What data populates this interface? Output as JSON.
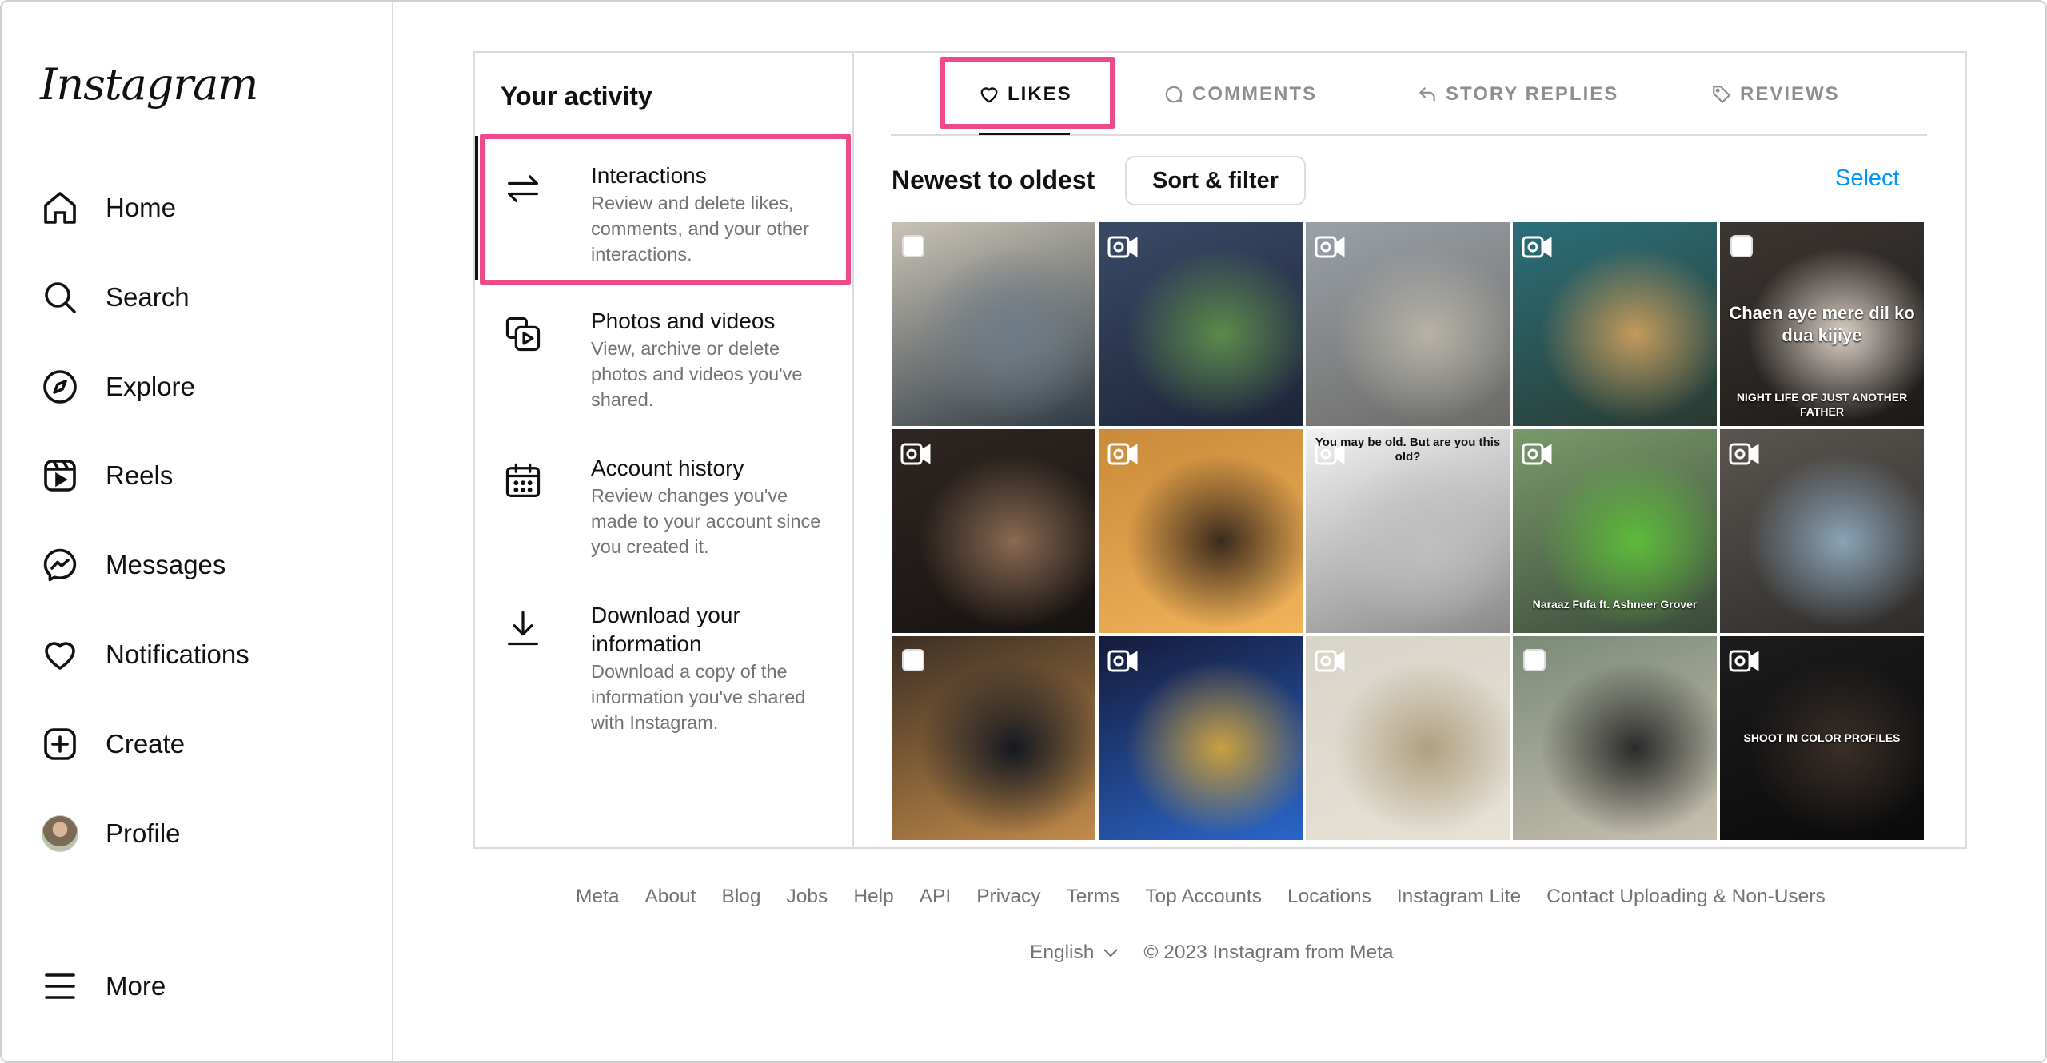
{
  "brand": "Instagram",
  "nav": [
    {
      "label": "Home",
      "icon": "home-icon"
    },
    {
      "label": "Search",
      "icon": "search-icon"
    },
    {
      "label": "Explore",
      "icon": "compass-icon"
    },
    {
      "label": "Reels",
      "icon": "reels-icon"
    },
    {
      "label": "Messages",
      "icon": "messenger-icon"
    },
    {
      "label": "Notifications",
      "icon": "heart-icon"
    },
    {
      "label": "Create",
      "icon": "plus-square-icon"
    },
    {
      "label": "Profile",
      "icon": "avatar"
    },
    {
      "label": "More",
      "icon": "menu-icon"
    }
  ],
  "activity": {
    "title": "Your activity",
    "items": [
      {
        "title": "Interactions",
        "desc": "Review and delete likes, comments, and your other interactions.",
        "icon": "arrows-icon"
      },
      {
        "title": "Photos and videos",
        "desc": "View, archive or delete photos and videos you've shared.",
        "icon": "media-icon"
      },
      {
        "title": "Account history",
        "desc": "Review changes you've made to your account since you created it.",
        "icon": "calendar-icon"
      },
      {
        "title": "Download your information",
        "desc": "Download a copy of the information you've shared with Instagram.",
        "icon": "download-icon"
      }
    ]
  },
  "tabs": [
    {
      "label": "LIKES",
      "icon": "heart-icon",
      "active": true
    },
    {
      "label": "COMMENTS",
      "icon": "comment-icon",
      "active": false
    },
    {
      "label": "STORY REPLIES",
      "icon": "reply-icon",
      "active": false
    },
    {
      "label": "REVIEWS",
      "icon": "tag-icon",
      "active": false
    }
  ],
  "sort": {
    "title": "Newest to oldest",
    "button": "Sort & filter",
    "select": "Select"
  },
  "tiles": [
    {
      "type": "image",
      "colors": [
        "#c9c3b6",
        "#6f7c86",
        "#2f3a44"
      ],
      "caption": ""
    },
    {
      "type": "video",
      "colors": [
        "#3a4a66",
        "#5c8a4a",
        "#1d2438"
      ],
      "caption": ""
    },
    {
      "type": "video",
      "colors": [
        "#9aa1a8",
        "#b7b2a7",
        "#6b6a66"
      ],
      "caption": ""
    },
    {
      "type": "video",
      "colors": [
        "#2b6f7a",
        "#c39a5c",
        "#2a3a30"
      ],
      "caption": ""
    },
    {
      "type": "image",
      "colors": [
        "#3c3632",
        "#d9cfc6",
        "#1c1a18"
      ],
      "caption": "Chaen aye mere dil ko dua kijiye",
      "caption2": "NIGHT LIFE OF JUST ANOTHER FATHER"
    },
    {
      "type": "video",
      "colors": [
        "#2e2622",
        "#8a6a52",
        "#161211"
      ],
      "caption": ""
    },
    {
      "type": "video",
      "colors": [
        "#c98a3a",
        "#3b2a1d",
        "#f2b45a"
      ],
      "caption": ""
    },
    {
      "type": "video",
      "colors": [
        "#f2f2f2",
        "#bfbfbf",
        "#8a8a8a"
      ],
      "caption": "You may be old. But are you this old?"
    },
    {
      "type": "video",
      "colors": [
        "#7a9a6a",
        "#5dbb3a",
        "#3a4a3a"
      ],
      "caption": "",
      "caption2": "Naraaz Fufa ft. Ashneer Grover"
    },
    {
      "type": "video",
      "colors": [
        "#5a5550",
        "#8aa4b8",
        "#2f2c2a"
      ],
      "caption": ""
    },
    {
      "type": "image",
      "colors": [
        "#3d2f24",
        "#141821",
        "#c28b4a"
      ],
      "caption": ""
    },
    {
      "type": "video",
      "colors": [
        "#151a3a",
        "#c9a040",
        "#2a66c9"
      ],
      "caption": ""
    },
    {
      "type": "video",
      "colors": [
        "#d8d4c9",
        "#b0a080",
        "#e6e2d6"
      ],
      "caption": ""
    },
    {
      "type": "image",
      "colors": [
        "#7b8a78",
        "#2a2a2a",
        "#c8c0b0"
      ],
      "caption": ""
    },
    {
      "type": "video",
      "colors": [
        "#1c1c1c",
        "#3a2e28",
        "#0a0a0a"
      ],
      "caption": "",
      "caption2": "SHOOT IN COLOR PROFILES"
    }
  ],
  "footer": {
    "links": [
      "Meta",
      "About",
      "Blog",
      "Jobs",
      "Help",
      "API",
      "Privacy",
      "Terms",
      "Top Accounts",
      "Locations",
      "Instagram Lite",
      "Contact Uploading & Non-Users"
    ],
    "language": "English",
    "copyright": "© 2023 Instagram from Meta"
  },
  "colors": {
    "highlight": "#ec4a8a",
    "link": "#0095f6"
  }
}
